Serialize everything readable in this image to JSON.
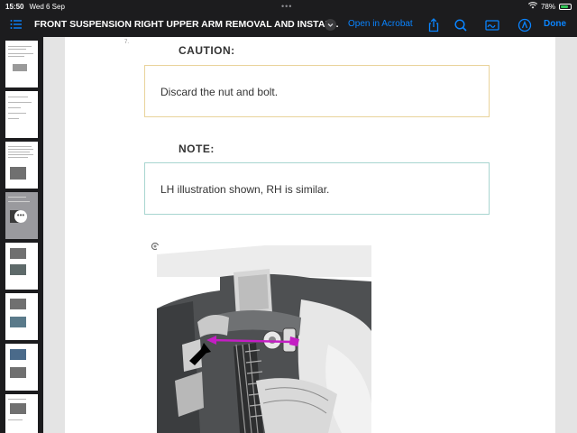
{
  "status_bar": {
    "time": "15:50",
    "date": "Wed 6 Sep",
    "battery": "78%",
    "battery_level": 0.78,
    "multitask_dots": "•••"
  },
  "toolbar": {
    "title": "FRONT SUSPENSION  RIGHT UPPER ARM REMOVAL AND INSTAL...",
    "open_in_acrobat": "Open in Acrobat",
    "done": "Done",
    "icons": [
      "list-icon",
      "chevron-down-icon",
      "share-icon",
      "search-icon",
      "sign-icon",
      "annotate-icon"
    ]
  },
  "sidebar": {
    "selected_index": 3,
    "more_glyph": "•••"
  },
  "document": {
    "page_mark": "7.",
    "caution": {
      "heading": "CAUTION:",
      "text": "Discard the nut and bolt."
    },
    "note": {
      "heading": "NOTE:",
      "text": "LH illustration shown, RH is similar."
    }
  },
  "colors": {
    "accent": "#0a84ff",
    "caution_border": "#e9d39a",
    "note_border": "#a8d5d0",
    "callout_arrow": "#c41ec4"
  }
}
